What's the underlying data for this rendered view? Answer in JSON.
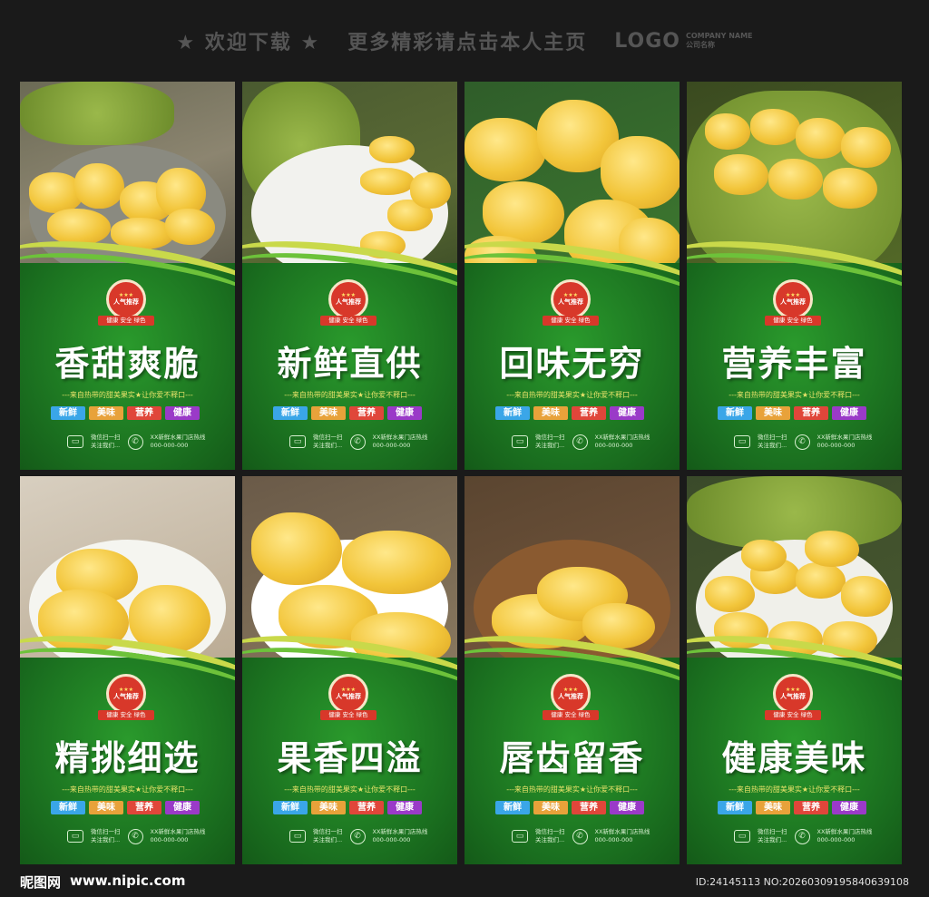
{
  "header": {
    "welcome": "★ 欢迎下载 ★",
    "more": "更多精彩请点击本人主页",
    "logo": "LOGO",
    "company_name_en": "COMPANY NAME",
    "company_name_cn": "公司名称"
  },
  "common": {
    "badge_top": "人气推荐",
    "badge_stars": "★★★",
    "badge_sub": "健康 安全 绿色",
    "slogan": "---来自热带的甜美果实★让你爱不释口---",
    "tags": [
      "新鲜",
      "美味",
      "营养",
      "健康"
    ],
    "tag_colors": [
      "#3aa6e8",
      "#e8a23a",
      "#e0463a",
      "#9a3ac8"
    ],
    "wechat_line1": "微信扫一扫",
    "wechat_line2": "关注我们...",
    "shop_line1": "XX新鲜水果门店热线",
    "shop_line2": "000-000-000"
  },
  "panels": [
    {
      "title": "香甜爽脆"
    },
    {
      "title": "新鲜直供"
    },
    {
      "title": "回味无穷"
    },
    {
      "title": "营养丰富"
    },
    {
      "title": "精挑细选"
    },
    {
      "title": "果香四溢"
    },
    {
      "title": "唇齿留香"
    },
    {
      "title": "健康美味"
    }
  ],
  "footer": {
    "brand": "昵图网",
    "url": "www.nipic.com",
    "ids": "ID:24145113 NO:20260309195840639108"
  },
  "colors": {
    "panel_green": "#1f7a24",
    "fruit_yellow": "#f2c53a",
    "badge_red": "#d8382a"
  }
}
